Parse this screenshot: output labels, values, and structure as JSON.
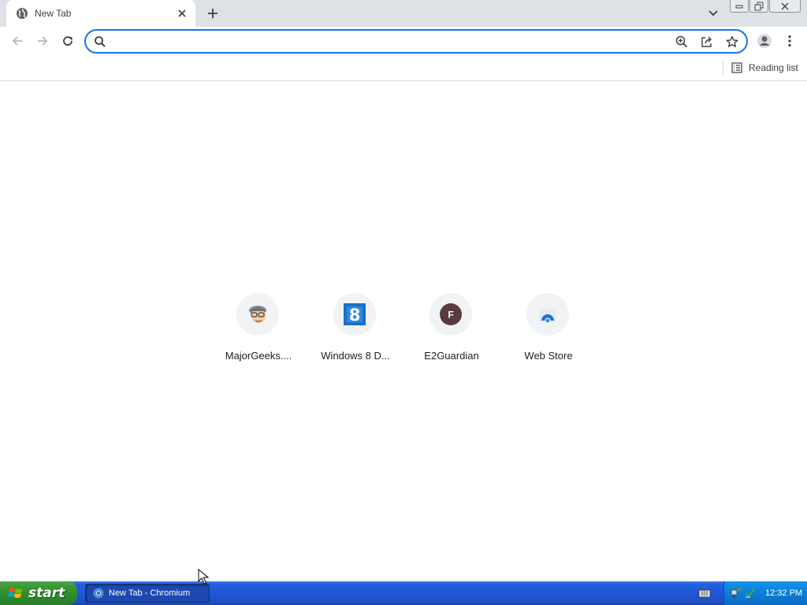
{
  "window": {
    "tab_title": "New Tab",
    "minimize_label": "Minimize",
    "restore_label": "Restore",
    "close_label": "Close"
  },
  "toolbar": {
    "omnibox_value": "",
    "omnibox_placeholder": ""
  },
  "bookmarks": {
    "reading_list_label": "Reading list"
  },
  "shortcuts": [
    {
      "label": "MajorGeeks....",
      "icon": "majorgeeks-icon"
    },
    {
      "label": "Windows 8 D...",
      "icon": "windows8-icon"
    },
    {
      "label": "E2Guardian",
      "icon": "letter-f-icon",
      "letter": "F"
    },
    {
      "label": "Web Store",
      "icon": "webstore-icon"
    }
  ],
  "taskbar": {
    "start_label": "start",
    "task_label": "New Tab - Chromium",
    "clock": "12:32 PM"
  },
  "colors": {
    "accent": "#1a73e8",
    "tabstrip": "#dee1e6",
    "e2guardian_icon": "#5b3a3f",
    "taskbar": "#245edb",
    "start_button": "#3c9a36"
  }
}
